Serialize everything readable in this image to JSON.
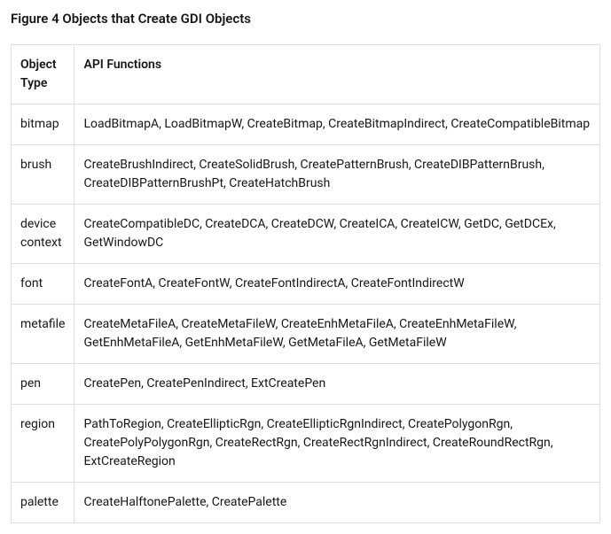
{
  "title": "Figure 4 Objects that Create GDI Objects",
  "headers": {
    "type": "Object Type",
    "functions": "API Functions"
  },
  "rows": [
    {
      "type": "bitmap",
      "functions": "LoadBitmapA, LoadBitmapW, CreateBitmap, CreateBitmapIndirect, CreateCompatibleBitmap"
    },
    {
      "type": "brush",
      "functions": "CreateBrushIndirect, CreateSolidBrush, CreatePatternBrush, CreateDIBPatternBrush, CreateDIBPatternBrushPt, CreateHatchBrush"
    },
    {
      "type": "device context",
      "functions": "CreateCompatibleDC, CreateDCA, CreateDCW, CreateICA, CreateICW, GetDC, GetDCEx, GetWindowDC"
    },
    {
      "type": "font",
      "functions": "CreateFontA, CreateFontW, CreateFontIndirectA, CreateFontIndirectW"
    },
    {
      "type": "metafile",
      "functions": "CreateMetaFileA, CreateMetaFileW, CreateEnhMetaFileA, CreateEnhMetaFileW, GetEnhMetaFileA, GetEnhMetaFileW, GetMetaFileA, GetMetaFileW"
    },
    {
      "type": "pen",
      "functions": "CreatePen, CreatePenIndirect, ExtCreatePen"
    },
    {
      "type": "region",
      "functions": "PathToRegion, CreateEllipticRgn, CreateEllipticRgnIndirect, CreatePolygonRgn, CreatePolyPolygonRgn, CreateRectRgn, CreateRectRgnIndirect, CreateRoundRectRgn, ExtCreateRegion"
    },
    {
      "type": "palette",
      "functions": "CreateHalftonePalette, CreatePalette"
    }
  ]
}
